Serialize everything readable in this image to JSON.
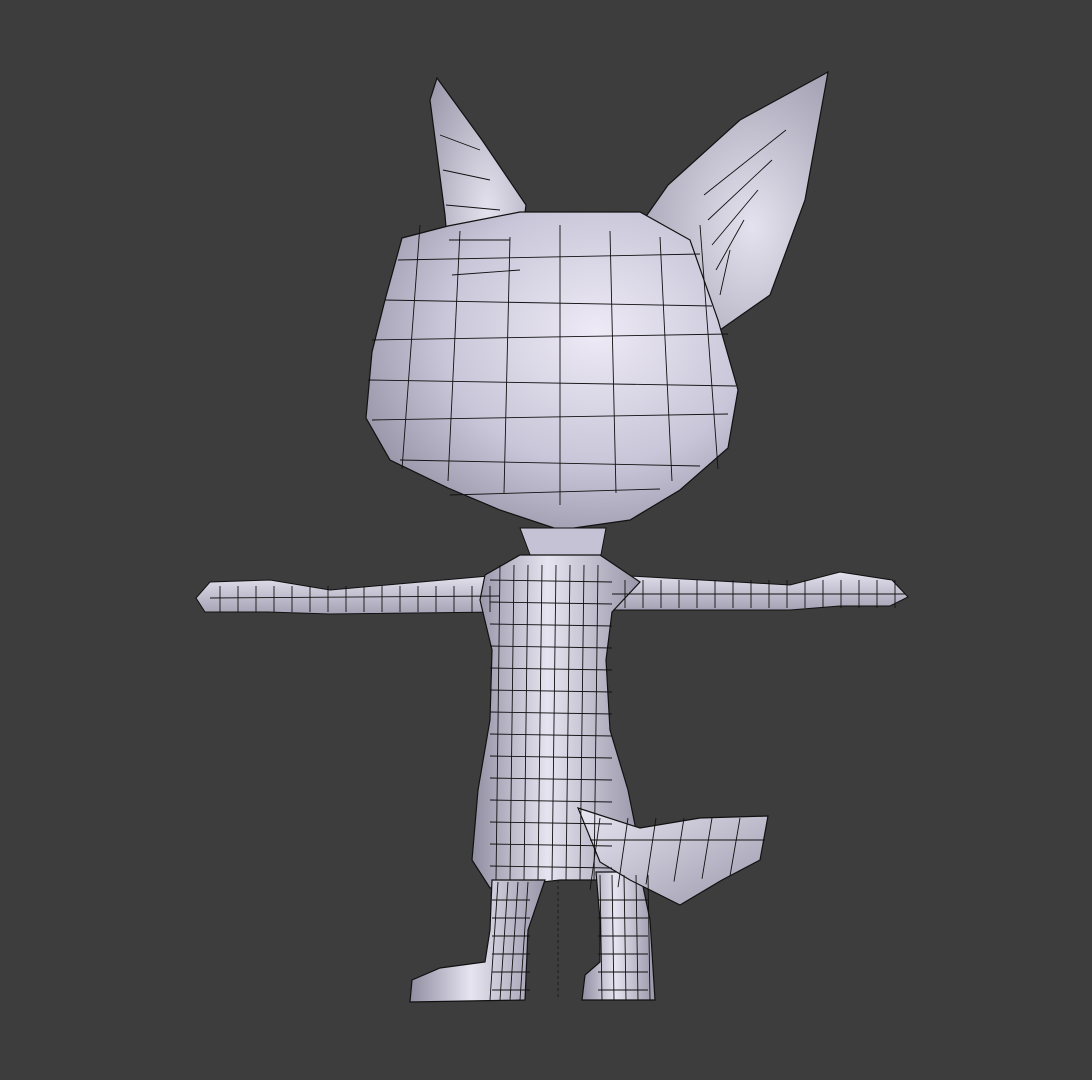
{
  "viewport": {
    "background": "#3d3d3d",
    "mesh_fill": "#c9c9d9",
    "mesh_highlight": "#eceaf4",
    "mesh_shadow": "#8c8c9c",
    "wire_color": "#111111"
  },
  "scene": {
    "object": "cat-character-mesh",
    "pose": "t-pose",
    "shading": "solid-with-wireframe"
  }
}
